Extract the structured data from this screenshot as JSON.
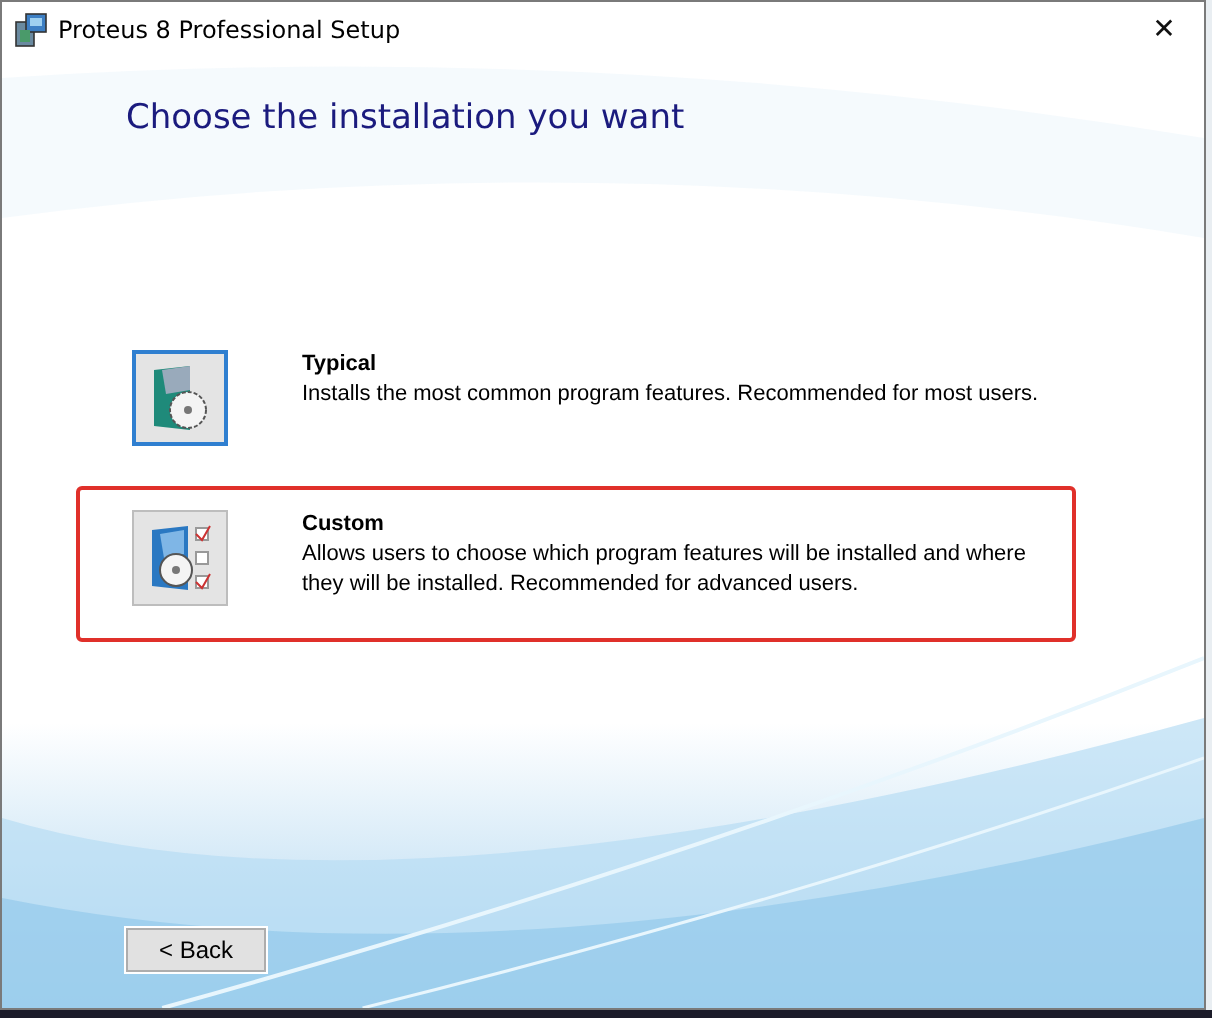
{
  "window": {
    "title": "Proteus 8 Professional Setup",
    "close": "✕"
  },
  "heading": "Choose the installation you want",
  "options": [
    {
      "kind": "typical",
      "title": "Typical",
      "description": "Installs the most common program features. Recommended for most users.",
      "selected": true,
      "annotated": false
    },
    {
      "kind": "custom",
      "title": "Custom",
      "description": "Allows users to choose which program features will be installed and where they will be installed. Recommended for advanced users.",
      "selected": false,
      "annotated": true
    }
  ],
  "buttons": [
    {
      "label": "< Back"
    }
  ]
}
